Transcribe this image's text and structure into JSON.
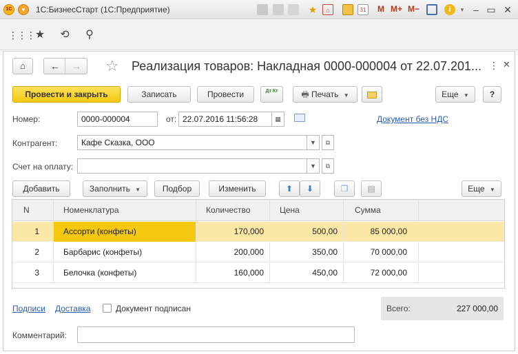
{
  "window": {
    "logo_text": "1С",
    "title": "1С:БизнесСтарт  (1С:Предприятие)",
    "letters": [
      "M",
      "M+",
      "M−"
    ]
  },
  "form": {
    "title": "Реализация товаров: Накладная 0000-000004 от 22.07.201...",
    "toolbar": {
      "post_close": "Провести и закрыть",
      "save": "Записать",
      "post": "Провести",
      "dtkt": "Дт Кт",
      "print": "Печать",
      "more": "Еще",
      "help": "?"
    },
    "number_label": "Номер:",
    "number_value": "0000-000004",
    "date_label": "от:",
    "date_value": "22.07.2016 11:56:28",
    "vat_link": "Документ без НДС",
    "contractor_label": "Контрагент:",
    "contractor_value": "Кафе Сказка, ООО",
    "invoice_label": "Счет на оплату:",
    "invoice_value": "",
    "table_toolbar": {
      "add": "Добавить",
      "fill": "Заполнить",
      "select": "Подбор",
      "change": "Изменить",
      "more": "Еще"
    },
    "columns": [
      "N",
      "Номенклатура",
      "Количество",
      "Цена",
      "Сумма"
    ],
    "rows": [
      {
        "n": "1",
        "item": "Ассорти (конфеты)",
        "qty": "170,000",
        "price": "500,00",
        "sum": "85 000,00"
      },
      {
        "n": "2",
        "item": "Барбарис (конфеты)",
        "qty": "200,000",
        "price": "350,00",
        "sum": "70 000,00"
      },
      {
        "n": "3",
        "item": "Белочка (конфеты)",
        "qty": "160,000",
        "price": "450,00",
        "sum": "72 000,00"
      }
    ],
    "links": {
      "signatures": "Подписи",
      "delivery": "Доставка"
    },
    "signed_label": "Документ подписан",
    "signed_checked": false,
    "total_label": "Всего:",
    "total_value": "227 000,00",
    "comment_label": "Комментарий:",
    "comment_value": ""
  },
  "colors": {
    "accent": "#f6c80e",
    "selected_row": "#fbe8a6",
    "link": "#2a5db0"
  }
}
